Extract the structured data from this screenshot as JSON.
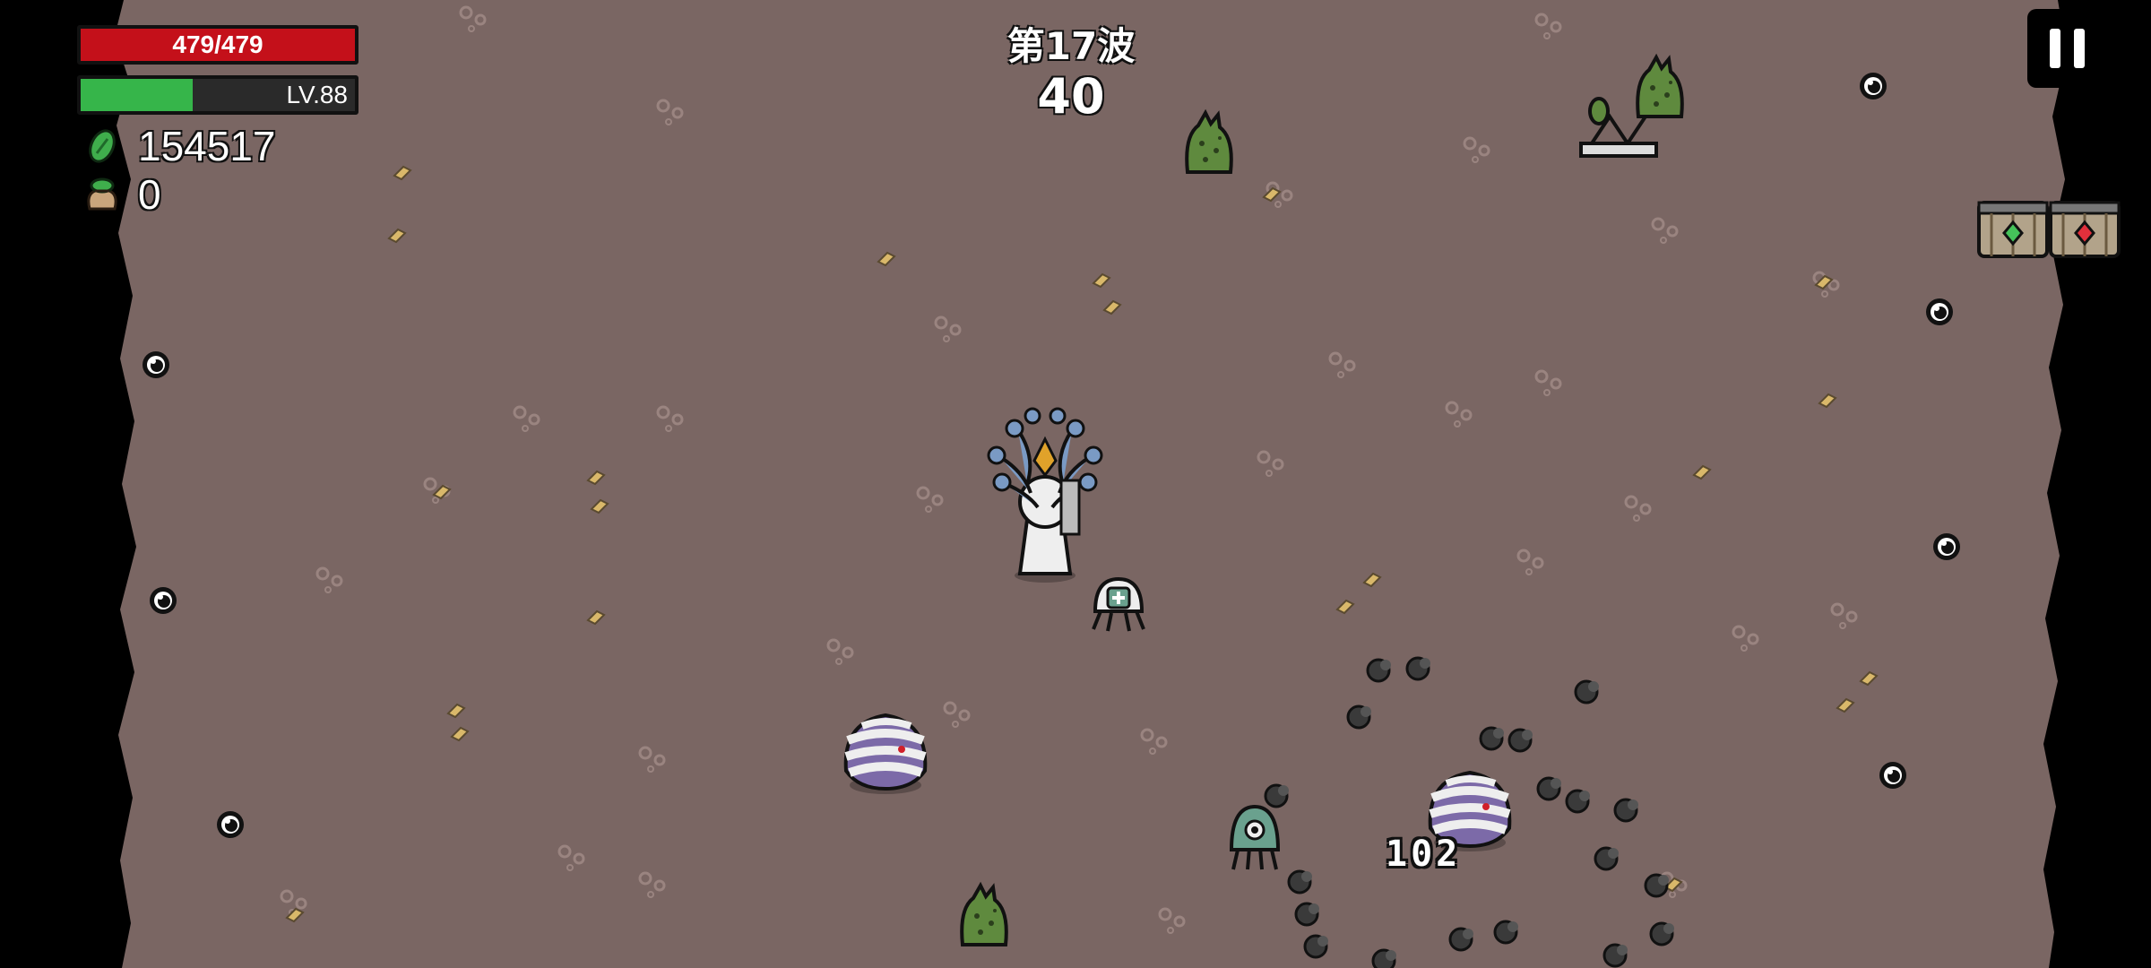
{
  "hud": {
    "hp_text": "479/479",
    "hp_current": 479,
    "hp_max": 479,
    "level_text": "LV.88",
    "xp_fraction": 0.41,
    "materials_count": "154517",
    "bag_count": "0",
    "wave_label": "第17波",
    "wave_timer": "40",
    "pause_icon": "pause-icon"
  },
  "world": {
    "damage_number": "102",
    "colors": {
      "ground": "#7a6663",
      "border": "#000000",
      "hp": "#c4101a",
      "xp": "#36b54a"
    }
  }
}
